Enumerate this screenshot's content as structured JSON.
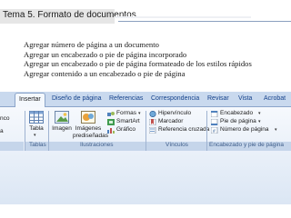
{
  "slide": {
    "title": "Tema 5. Formato de documentos",
    "bullets": [
      "Agregar número de página a un documento",
      "Agregar un encabezado o pie de página incorporado",
      "Agregar un encabezado o pie de página formateado de los estilos rápidos",
      "Agregar contenido a un encabezado o pie de página"
    ]
  },
  "ribbon": {
    "tabs": [
      "Insertar",
      "Diseño de página",
      "Referencias",
      "Correspondencia",
      "Revisar",
      "Vista",
      "Acrobat"
    ],
    "active_tab": "Insertar",
    "left_fragments": [
      "nco",
      "a"
    ],
    "groups": {
      "tablas": {
        "label": "Tablas",
        "tabla_label": "Tabla"
      },
      "ilustraciones": {
        "label": "Ilustraciones",
        "imagen": "Imagen",
        "imagenes_line1": "Imágenes",
        "imagenes_line2": "prediseñadas",
        "formas": "Formas",
        "smartart": "SmartArt",
        "grafico": "Gráfico"
      },
      "vinculos": {
        "label": "Vínculos",
        "hipervinculo": "Hipervínculo",
        "marcador": "Marcador",
        "referencia_cruzada": "Referencia cruzada"
      },
      "encabezado": {
        "label": "Encabezado y pie de página",
        "encabezado": "Encabezado",
        "pie": "Pie de página",
        "numero": "Número de página"
      }
    }
  },
  "colors": {
    "ribbon_bg": "#dfe8f5",
    "tab_text": "#15428b",
    "group_label": "#3e5d8a"
  }
}
